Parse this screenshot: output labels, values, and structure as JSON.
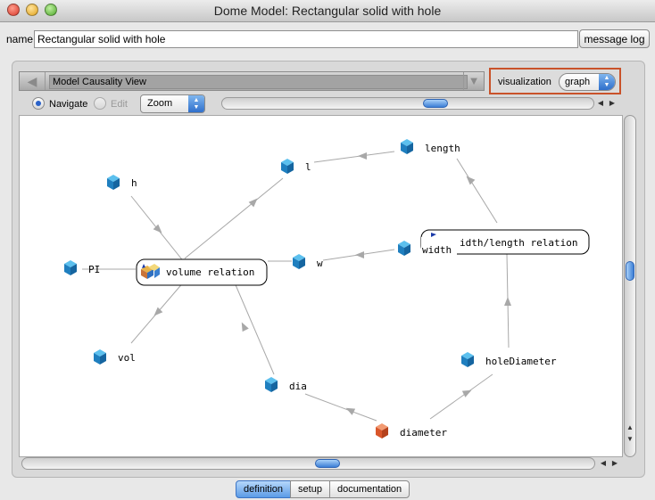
{
  "window": {
    "title": "Dome Model: Rectangular solid with hole"
  },
  "name_row": {
    "label": "name:",
    "value": "Rectangular solid with hole",
    "message_log_label": "message log"
  },
  "view_bar": {
    "view_name": "Model Causality View",
    "back_icon": "left-arrow-icon",
    "dropdown_icon": "down-triangle-icon"
  },
  "visualization": {
    "label": "visualization",
    "selected": "graph"
  },
  "toolbar": {
    "navigate_label": "Navigate",
    "navigate_selected": true,
    "edit_label": "Edit",
    "edit_selected": false,
    "zoom_selected": "Zoom"
  },
  "graph": {
    "nodes": {
      "h": "h",
      "pi": "PI",
      "vol": "vol",
      "l": "l",
      "length": "length",
      "w": "w",
      "width": "width",
      "holediameter": "holeDiameter",
      "dia": "dia",
      "diameter": "diameter",
      "volume_relation": "volume relation",
      "width_length_relation": "idth/length relation"
    },
    "colors": {
      "parameter": "#2a8fd0",
      "output": "#e0643a",
      "edge": "#a8a8a8"
    }
  },
  "tabs": [
    {
      "label": "definition",
      "active": true
    },
    {
      "label": "setup",
      "active": false
    },
    {
      "label": "documentation",
      "active": false
    }
  ]
}
